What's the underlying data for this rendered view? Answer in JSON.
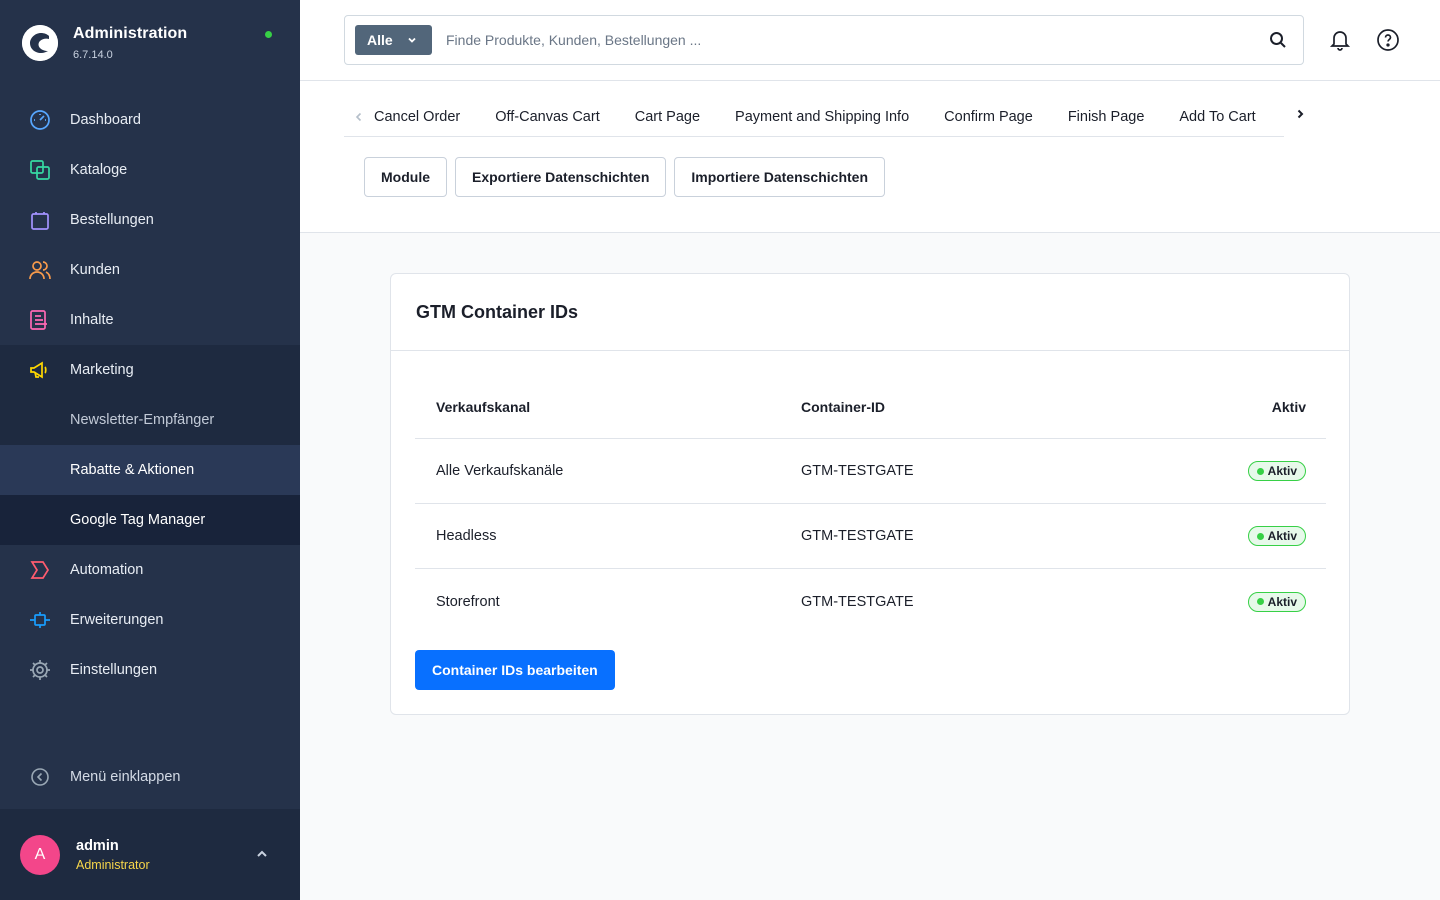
{
  "app": {
    "title": "Administration",
    "version": "6.7.14.0"
  },
  "nav": {
    "items": [
      {
        "label": "Dashboard",
        "color": "#57a7ff"
      },
      {
        "label": "Kataloge",
        "color": "#36d9a3"
      },
      {
        "label": "Bestellungen",
        "color": "#a392ff"
      },
      {
        "label": "Kunden",
        "color": "#f99b4b"
      },
      {
        "label": "Inhalte",
        "color": "#ff68b4"
      },
      {
        "label": "Marketing",
        "color": "#ffd700"
      }
    ],
    "sub": [
      "Newsletter-Empfänger",
      "Rabatte & Aktionen",
      "Google Tag Manager"
    ],
    "after": [
      {
        "label": "Automation",
        "color": "#ff5c6f"
      },
      {
        "label": "Erweiterungen",
        "color": "#189eff"
      },
      {
        "label": "Einstellungen",
        "color": "#9aa8b5"
      }
    ],
    "collapse": "Menü einklappen"
  },
  "user": {
    "initial": "A",
    "name": "admin",
    "role": "Administrator"
  },
  "search": {
    "type": "Alle",
    "placeholder": "Finde Produkte, Kunden, Bestellungen ..."
  },
  "tabs": [
    "Cancel Order",
    "Off-Canvas Cart",
    "Cart Page",
    "Payment and Shipping Info",
    "Confirm Page",
    "Finish Page",
    "Add To Cart"
  ],
  "actions": [
    "Module",
    "Exportiere Datenschichten",
    "Importiere Datenschichten"
  ],
  "card": {
    "title": "GTM Container IDs",
    "columns": [
      "Verkaufskanal",
      "Container-ID",
      "Aktiv"
    ],
    "rows": [
      {
        "channel": "Alle Verkaufskanäle",
        "id": "GTM-TESTGATE",
        "status": "Aktiv"
      },
      {
        "channel": "Headless",
        "id": "GTM-TESTGATE",
        "status": "Aktiv"
      },
      {
        "channel": "Storefront",
        "id": "GTM-TESTGATE",
        "status": "Aktiv"
      }
    ],
    "edit_button": "Container IDs bearbeiten"
  }
}
